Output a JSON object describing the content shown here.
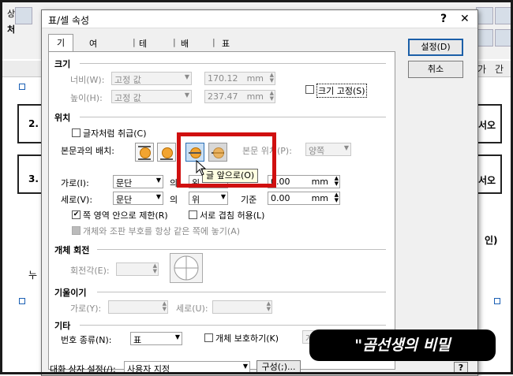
{
  "dialog": {
    "title": "표/셀 속성",
    "help_label": "?",
    "close_label": "✕",
    "tabs": [
      {
        "label": "기본"
      },
      {
        "label": "여백/캡션"
      },
      {
        "label": "테두리"
      },
      {
        "label": "배경"
      },
      {
        "label": "표"
      }
    ],
    "buttons": {
      "ok": "설정(D)",
      "cancel": "취소"
    },
    "size": {
      "title": "크기",
      "width_label": "너비(W):",
      "width_mode": "고정 값",
      "width_value": "170.12",
      "height_label": "높이(H):",
      "height_mode": "고정 값",
      "height_value": "237.47",
      "unit": "mm",
      "fix_size_label": "크기 고정(S)"
    },
    "position": {
      "title": "위치",
      "as_char_label": "글자처럼 취급(C)",
      "body_layout_label": "본문과의 배치:",
      "body_position_label": "본문 위치(P):",
      "body_position_value": "양쪽",
      "tooltip": "글 앞으로(O)",
      "horizontal_label": "가로(I):",
      "horizontal_value": "문단",
      "horizontal_ref_fragment": "의",
      "horizontal_align_fragment": "왼",
      "horizontal_offset": "0.00",
      "vertical_label": "세로(V):",
      "vertical_value": "문단",
      "vertical_ref_fragment": "의",
      "vertical_align_fragment": "위",
      "vertical_offset_label_fragment": "기준",
      "vertical_offset": "0.00",
      "unit": "mm",
      "limit_label": "쪽 영역 안으로 제한(R)",
      "overlap_label": "서로 겹침 허용(L)",
      "keep_label": "개체와 조판 부호를 항상 같은 쪽에 놓기(A)"
    },
    "rotation": {
      "title": "개체 회전",
      "angle_label": "회전각(E):"
    },
    "tilt": {
      "title": "기울이기",
      "horizontal_label": "가로(Y):",
      "vertical_label": "세로(U):"
    },
    "other": {
      "title": "기타",
      "numbering_label": "번호 종류(N):",
      "numbering_value": "표",
      "protect_label": "개체 보호하기(K)",
      "truncated_fragment": "개"
    },
    "footer": {
      "settings_label": "대화 상자 설정(/):",
      "settings_value": "사용자 지정",
      "config_label": "구성(;)..."
    }
  },
  "background": {
    "row_numbers": [
      "2.",
      "3."
    ],
    "left_fragments": [
      "상",
      "처",
      "누"
    ],
    "right_fragments": [
      "가",
      "간",
      "서오",
      "서오",
      "인)"
    ]
  },
  "watermark": "\"곰선생의 비밀"
}
